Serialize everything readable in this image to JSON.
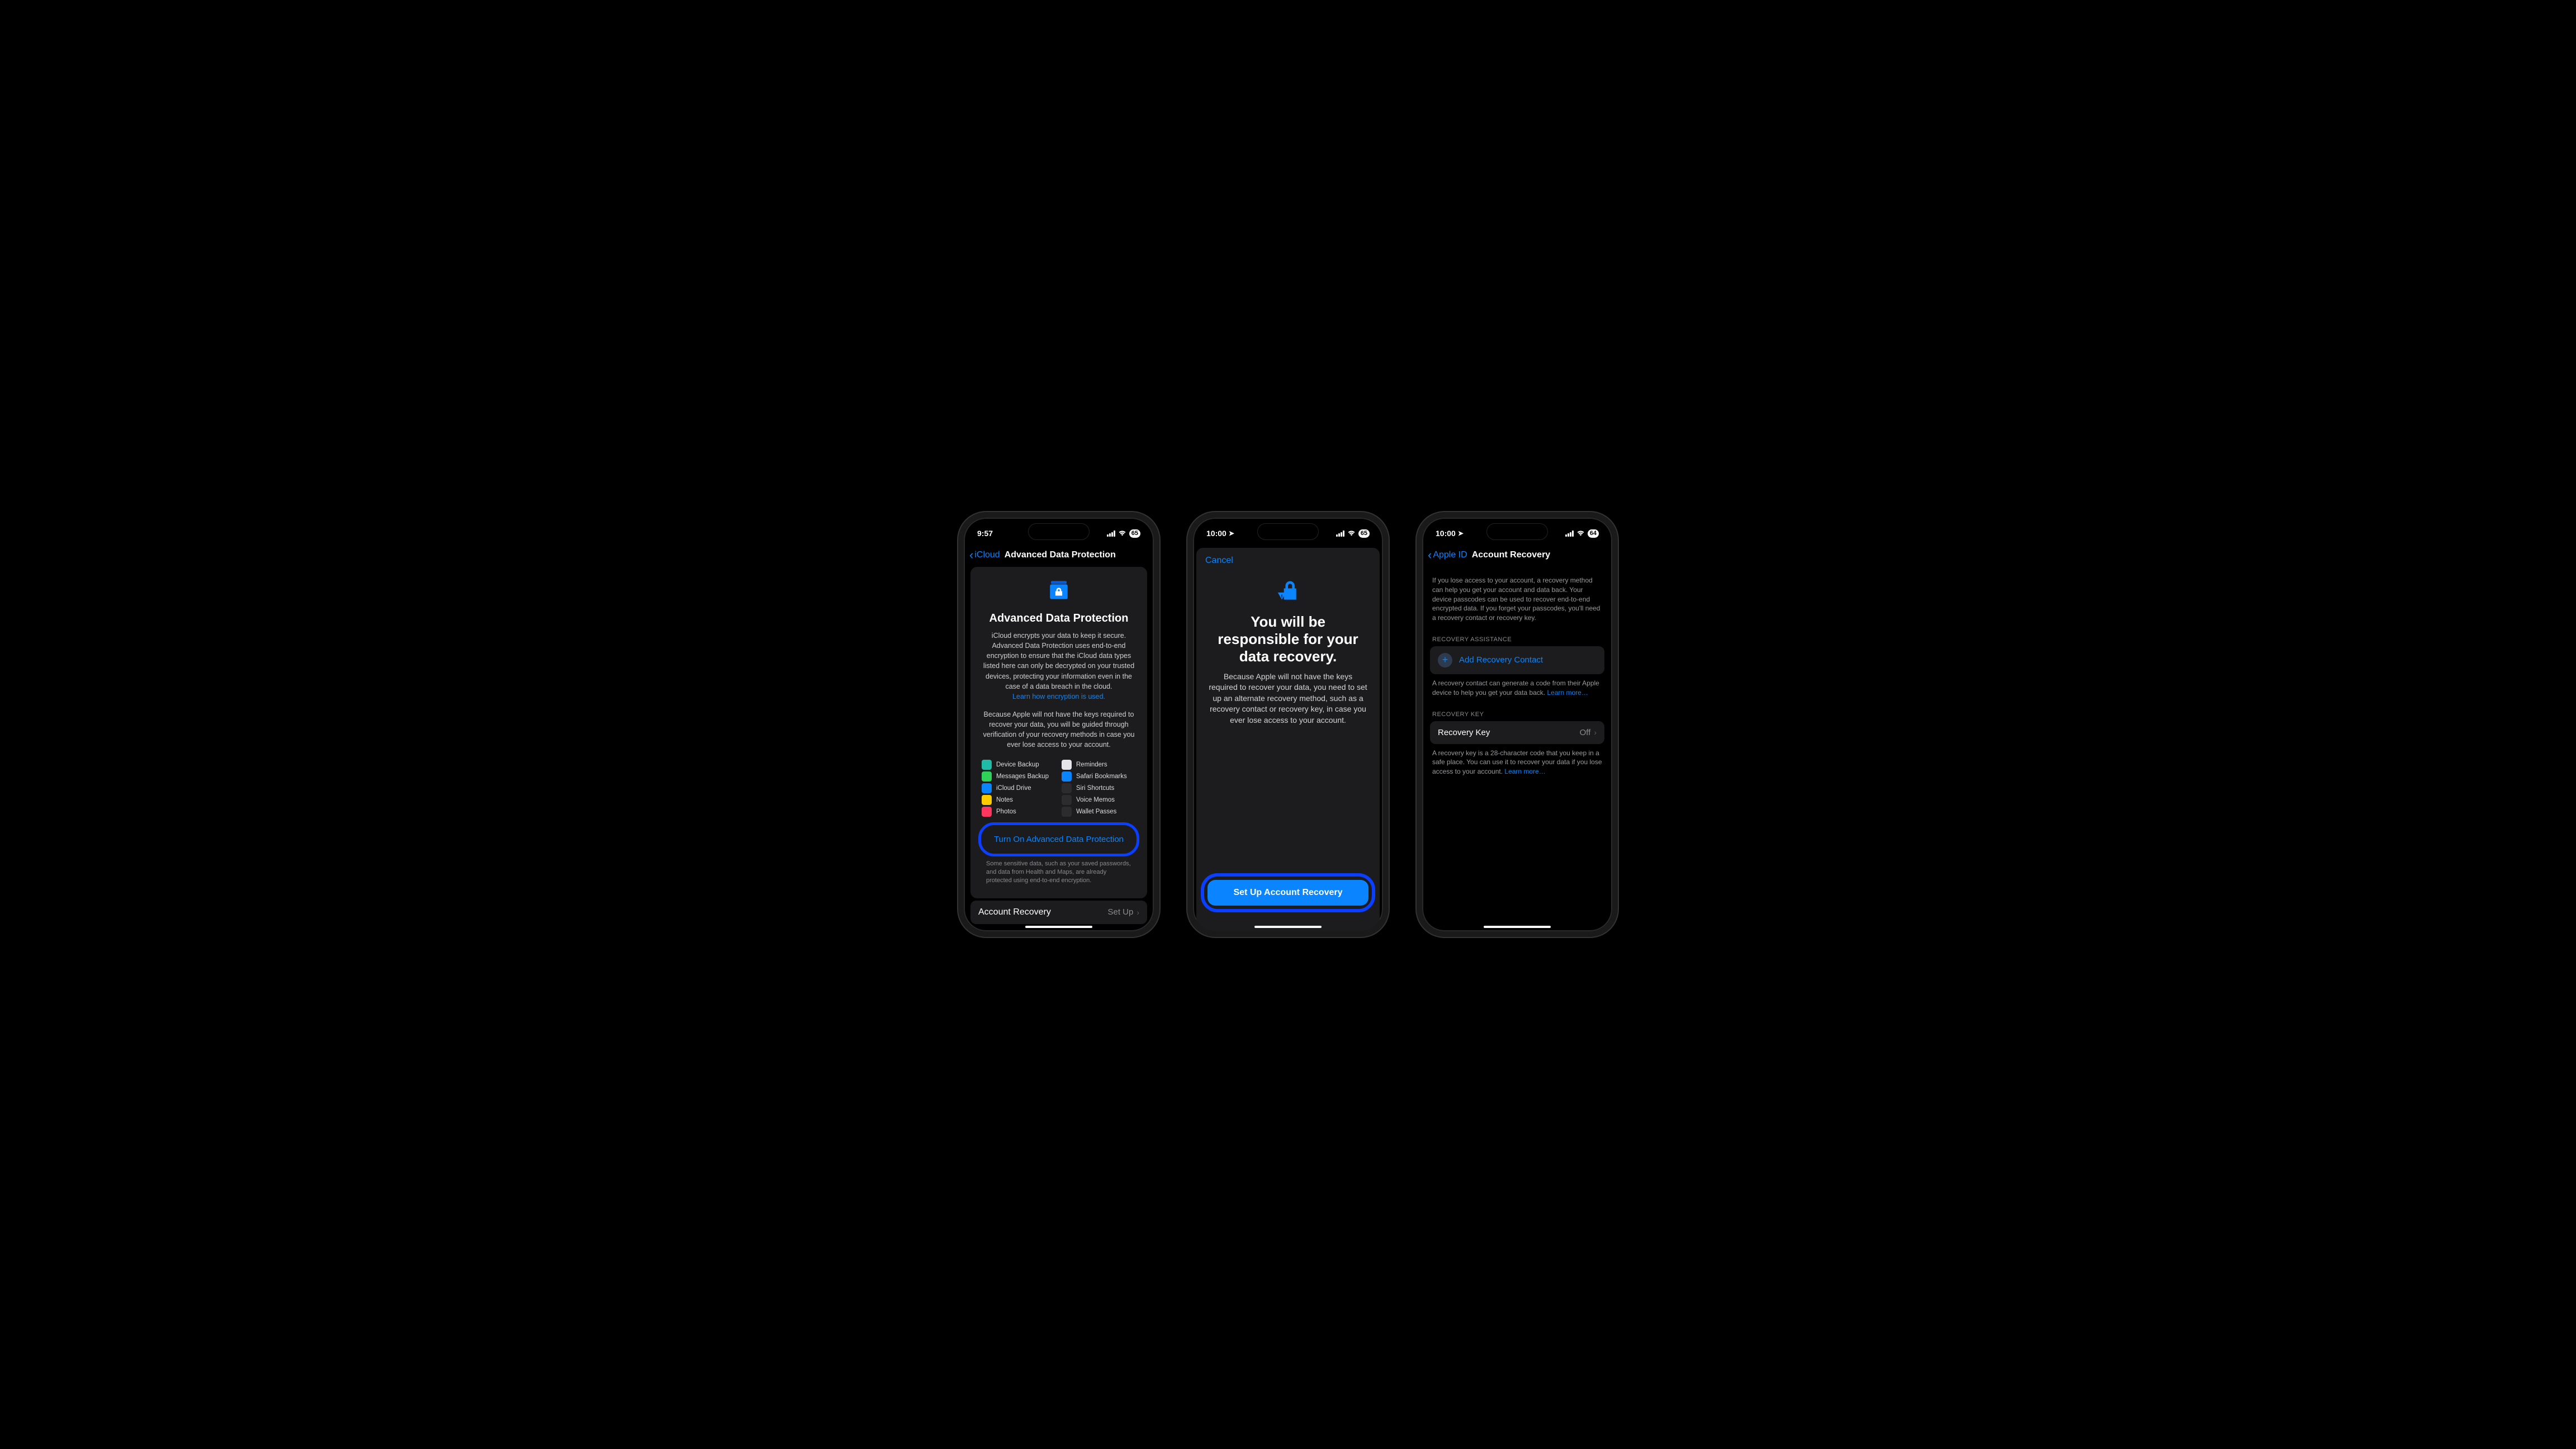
{
  "phone1": {
    "status": {
      "time": "9:57",
      "battery": "65"
    },
    "nav": {
      "back": "iCloud",
      "title": "Advanced Data Protection"
    },
    "card": {
      "title": "Advanced Data Protection",
      "body1": "iCloud encrypts your data to keep it secure. Advanced Data Protection uses end-to-end encryption to ensure that the iCloud data types listed here can only be decrypted on your trusted devices, protecting your information even in the case of a data breach in the cloud.",
      "learn_link": "Learn how encryption is used.",
      "body2": "Because Apple will not have the keys required to recover your data, you will be guided through verification of your recovery methods in case you ever lose access to your account.",
      "items_left": [
        {
          "label": "Device Backup",
          "color": "#1fbba6"
        },
        {
          "label": "Messages Backup",
          "color": "#30d158"
        },
        {
          "label": "iCloud Drive",
          "color": "#0a84ff"
        },
        {
          "label": "Notes",
          "color": "#ffcc00"
        },
        {
          "label": "Photos",
          "color": "#ff375f"
        }
      ],
      "items_right": [
        {
          "label": "Reminders",
          "color": "#e5e5ea"
        },
        {
          "label": "Safari Bookmarks",
          "color": "#0a84ff"
        },
        {
          "label": "Siri Shortcuts",
          "color": "#2c2c2e"
        },
        {
          "label": "Voice Memos",
          "color": "#2c2c2e"
        },
        {
          "label": "Wallet Passes",
          "color": "#2c2c2e"
        }
      ],
      "cta": "Turn On Advanced Data Protection",
      "footnote": "Some sensitive data, such as your saved passwords, and data from Health and Maps, are already protected using end-to-end encryption."
    },
    "row": {
      "label": "Account Recovery",
      "value": "Set Up"
    }
  },
  "phone2": {
    "status": {
      "time": "10:00",
      "battery": "65"
    },
    "sheet": {
      "cancel": "Cancel",
      "title": "You will be responsible for your data recovery.",
      "body": "Because Apple will not have the keys required to recover your data, you need to set up an alternate recovery method, such as a recovery contact or recovery key, in case you ever lose access to your account.",
      "cta": "Set Up Account Recovery"
    }
  },
  "phone3": {
    "status": {
      "time": "10:00",
      "battery": "64"
    },
    "nav": {
      "back": "Apple ID",
      "title": "Account Recovery"
    },
    "intro": "If you lose access to your account, a recovery method can help you get your account and data back. Your device passcodes can be used to recover end-to-end encrypted data. If you forget your passcodes, you'll need a recovery contact or recovery key.",
    "section1": {
      "header": "RECOVERY ASSISTANCE",
      "add_label": "Add Recovery Contact",
      "foot": "A recovery contact can generate a code from their Apple device to help you get your data back. ",
      "foot_link": "Learn more…"
    },
    "section2": {
      "header": "RECOVERY KEY",
      "label": "Recovery Key",
      "value": "Off",
      "foot": "A recovery key is a 28-character code that you keep in a safe place. You can use it to recover your data if you lose access to your account. ",
      "foot_link": "Learn more…"
    }
  }
}
